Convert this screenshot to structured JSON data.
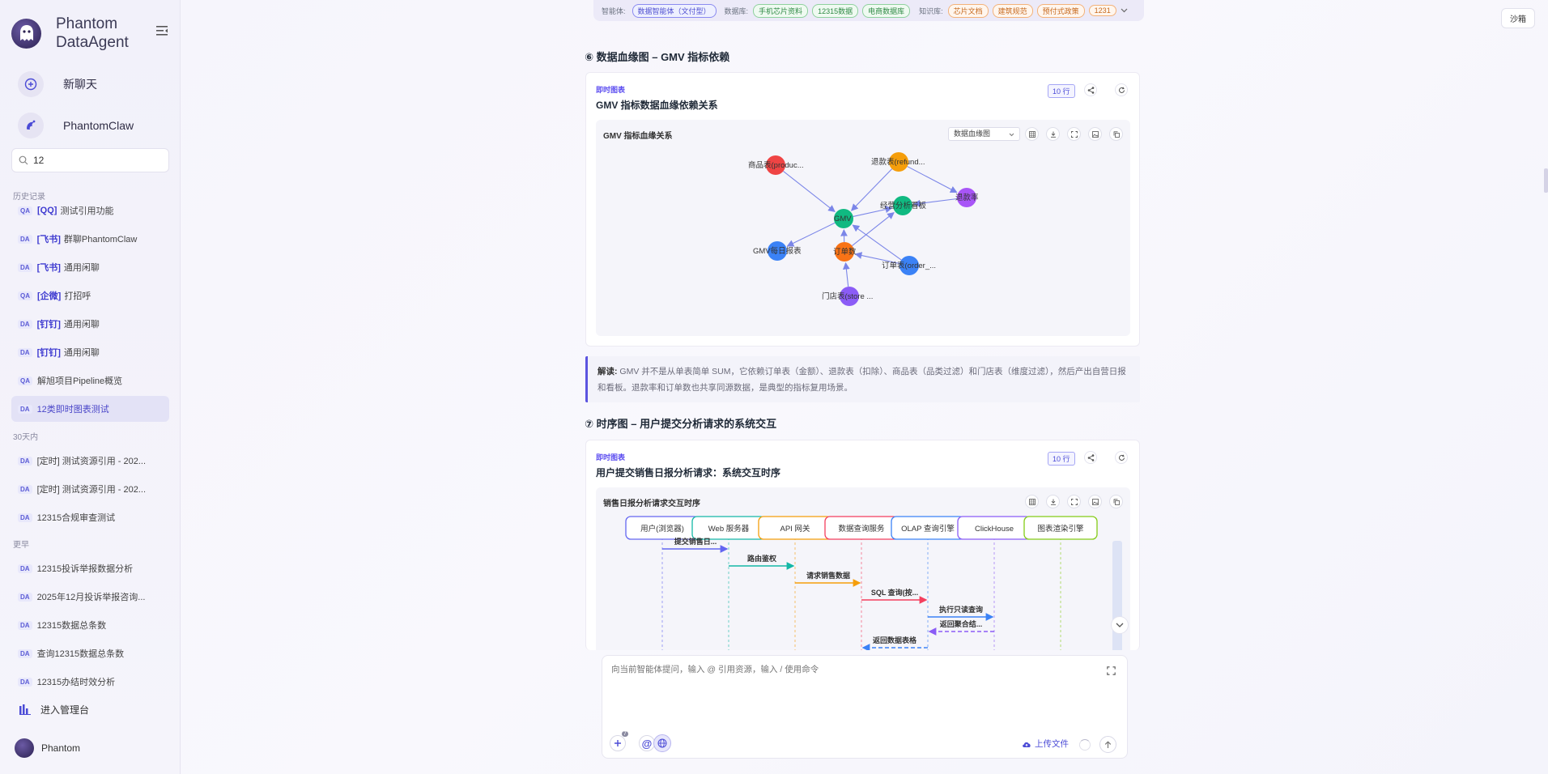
{
  "brand": {
    "line1": "Phantom",
    "line2": "DataAgent"
  },
  "sidebar": {
    "new_chat": "新聊天",
    "claw": "PhantomClaw",
    "search_value": "12",
    "sections": {
      "history": "历史记录",
      "days30": "30天内",
      "earlier": "更早"
    },
    "history_items": [
      {
        "type": "QA",
        "tag": "[QQ]",
        "text": "测试引用功能"
      },
      {
        "type": "DA",
        "tag": "[飞书]",
        "text": "群聊PhantomClaw"
      },
      {
        "type": "DA",
        "tag": "[飞书]",
        "text": "通用闲聊"
      },
      {
        "type": "QA",
        "tag": "[企微]",
        "text": "打招呼"
      },
      {
        "type": "DA",
        "tag": "[钉钉]",
        "text": "通用闲聊"
      },
      {
        "type": "DA",
        "tag": "[钉钉]",
        "text": "通用闲聊"
      },
      {
        "type": "QA",
        "tag": "",
        "text": "解旭项目Pipeline概览"
      },
      {
        "type": "DA",
        "tag": "",
        "text": "12类即时图表测试"
      }
    ],
    "days30_items": [
      {
        "type": "DA",
        "text": "[定时] 测试资源引用 - 202..."
      },
      {
        "type": "DA",
        "text": "[定时] 测试资源引用 - 202..."
      },
      {
        "type": "DA",
        "text": "12315合规审查测试"
      }
    ],
    "earlier_items": [
      {
        "type": "DA",
        "text": "12315投诉举报数据分析"
      },
      {
        "type": "DA",
        "text": "2025年12月投诉举报咨询..."
      },
      {
        "type": "DA",
        "text": "12315数据总条数"
      },
      {
        "type": "DA",
        "text": "查询12315数据总条数"
      },
      {
        "type": "DA",
        "text": "12315办结时效分析"
      }
    ],
    "admin": "进入管理台",
    "user": "Phantom"
  },
  "topbar": {
    "agent_label": "智能体:",
    "agent": "数据智能体（文付型）",
    "db_label": "数据库:",
    "dbs": [
      "手机芯片资料",
      "12315数据",
      "电商数据库"
    ],
    "kb_label": "知识库:",
    "kbs": [
      "芯片文档",
      "建筑规范",
      "预付式政策",
      "1231"
    ]
  },
  "sandbox": "沙箱",
  "section6": {
    "heading": "⑥ 数据血缘图 – GMV 指标依赖",
    "chart_tag": "即时图表",
    "title": "GMV 指标数据血缘依赖关系",
    "rows": "10 行",
    "inner_title": "GMV 指标血缘关系",
    "select": "数据血缘图"
  },
  "chart_data": {
    "type": "graph",
    "title": "GMV 指标血缘关系",
    "nodes": [
      {
        "id": "商品表(produc...",
        "color": "#ef4444"
      },
      {
        "id": "退款表(refund...",
        "color": "#f59e0b"
      },
      {
        "id": "退款率",
        "color": "#a855f7"
      },
      {
        "id": "经营分析看板",
        "color": "#10b981"
      },
      {
        "id": "GMV",
        "color": "#10b981"
      },
      {
        "id": "GMV每日报表",
        "color": "#3b82f6"
      },
      {
        "id": "订单数",
        "color": "#f97316"
      },
      {
        "id": "订单表(order_...",
        "color": "#3b82f6"
      },
      {
        "id": "门店表(store ...",
        "color": "#8b5cf6"
      }
    ],
    "edges": [
      {
        "from": "商品表(produc...",
        "to": "GMV"
      },
      {
        "from": "退款表(refund...",
        "to": "GMV"
      },
      {
        "from": "退款表(refund...",
        "to": "退款率"
      },
      {
        "from": "退款率",
        "to": "经营分析看板"
      },
      {
        "from": "GMV",
        "to": "经营分析看板"
      },
      {
        "from": "GMV",
        "to": "GMV每日报表"
      },
      {
        "from": "订单数",
        "to": "经营分析看板"
      },
      {
        "from": "订单表(order_...",
        "to": "GMV"
      },
      {
        "from": "订单表(order_...",
        "to": "订单数"
      },
      {
        "from": "门店表(store ...",
        "to": "订单数"
      },
      {
        "from": "订单数",
        "to": "GMV"
      }
    ]
  },
  "note": {
    "label": "解读:",
    "text": "GMV 并不是从单表简单 SUM，它依赖订单表（金额）、退款表（扣除）、商品表（品类过滤）和门店表（维度过滤），然后产出自营日报和看板。退款率和订单数也共享同源数据，是典型的指标复用场景。"
  },
  "section7": {
    "heading": "⑦ 时序图 – 用户提交分析请求的系统交互",
    "chart_tag": "即时图表",
    "title": "用户提交销售日报分析请求：系统交互时序",
    "rows": "10 行",
    "inner_title": "销售日报分析请求交互时序"
  },
  "sequence": {
    "actors": [
      {
        "name": "用户(浏览器)",
        "color": "#6366f1"
      },
      {
        "name": "Web 服务器",
        "color": "#14b8a6"
      },
      {
        "name": "API 网关",
        "color": "#f59e0b"
      },
      {
        "name": "数据查询服务",
        "color": "#f43f5e"
      },
      {
        "name": "OLAP 查询引擎",
        "color": "#3b82f6"
      },
      {
        "name": "ClickHouse",
        "color": "#8b5cf6"
      },
      {
        "name": "图表渲染引擎",
        "color": "#84cc16"
      }
    ],
    "messages": [
      {
        "from": 0,
        "to": 1,
        "label": "提交销售日...",
        "dashed": false
      },
      {
        "from": 1,
        "to": 2,
        "label": "路由鉴权",
        "dashed": false
      },
      {
        "from": 2,
        "to": 3,
        "label": "请求销售数据",
        "dashed": false
      },
      {
        "from": 3,
        "to": 4,
        "label": "SQL 查询(按...",
        "dashed": false
      },
      {
        "from": 4,
        "to": 5,
        "label": "执行只读查询",
        "dashed": false
      },
      {
        "from": 5,
        "to": 4,
        "label": "返回聚合结...",
        "dashed": true
      },
      {
        "from": 4,
        "to": 3,
        "label": "返回数据表格",
        "dashed": true
      }
    ]
  },
  "composer": {
    "placeholder": "向当前智能体提问，输入 @ 引用资源，输入 / 使用命令",
    "upload": "上传文件",
    "attach_count": "7"
  }
}
